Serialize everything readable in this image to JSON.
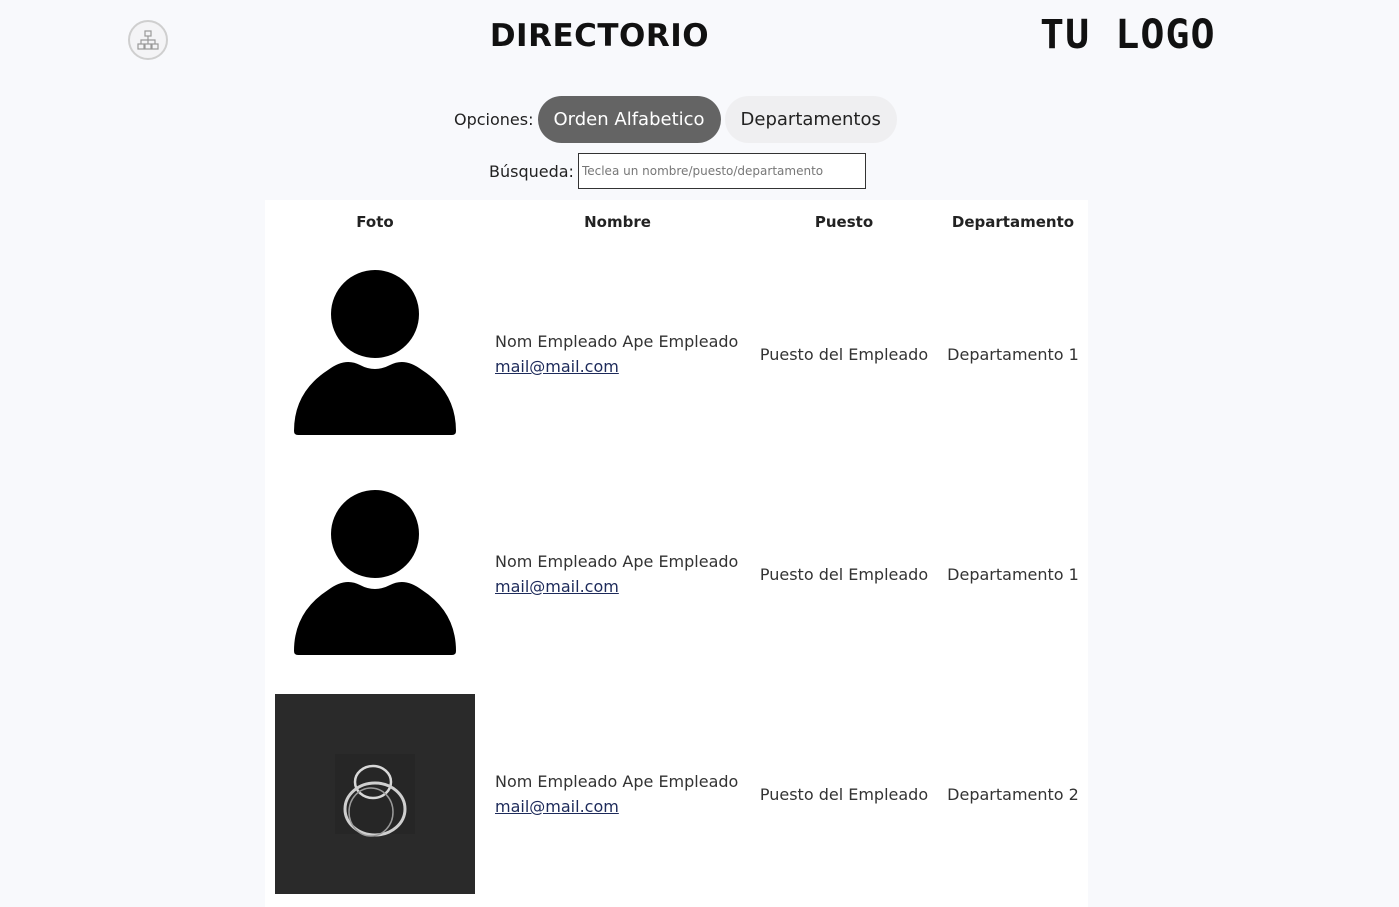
{
  "header": {
    "title": "DIRECTORIO",
    "logo": "TU LOGO",
    "org_chart_icon": "org-chart-icon"
  },
  "options": {
    "label": "Opciones:",
    "tabs": [
      {
        "label": "Orden Alfabetico",
        "active": true
      },
      {
        "label": "Departamentos",
        "active": false
      }
    ]
  },
  "search": {
    "label": "Búsqueda:",
    "value": "",
    "placeholder": "Teclea un nombre/puesto/departamento"
  },
  "table": {
    "headers": [
      "Foto",
      "Nombre",
      "Puesto",
      "Departamento"
    ],
    "rows": [
      {
        "photo": "person-silhouette-icon",
        "name": "Nom Empleado Ape Empleado",
        "email": "mail@mail.com",
        "puesto": "Puesto del Empleado",
        "departamento": "Departamento 1"
      },
      {
        "photo": "person-silhouette-icon",
        "name": "Nom Empleado Ape Empleado",
        "email": "mail@mail.com",
        "puesto": "Puesto del Empleado",
        "departamento": "Departamento 1"
      },
      {
        "photo": "abstract-ring-photo",
        "name": "Nom Empleado Ape Empleado",
        "email": "mail@mail.com",
        "puesto": "Puesto del Empleado",
        "departamento": "Departamento 2"
      }
    ]
  },
  "colors": {
    "active_tab_bg": "#646464",
    "inactive_tab_bg": "#efeff1",
    "page_bg": "#f8f9fc",
    "link": "#1d2a5a"
  }
}
